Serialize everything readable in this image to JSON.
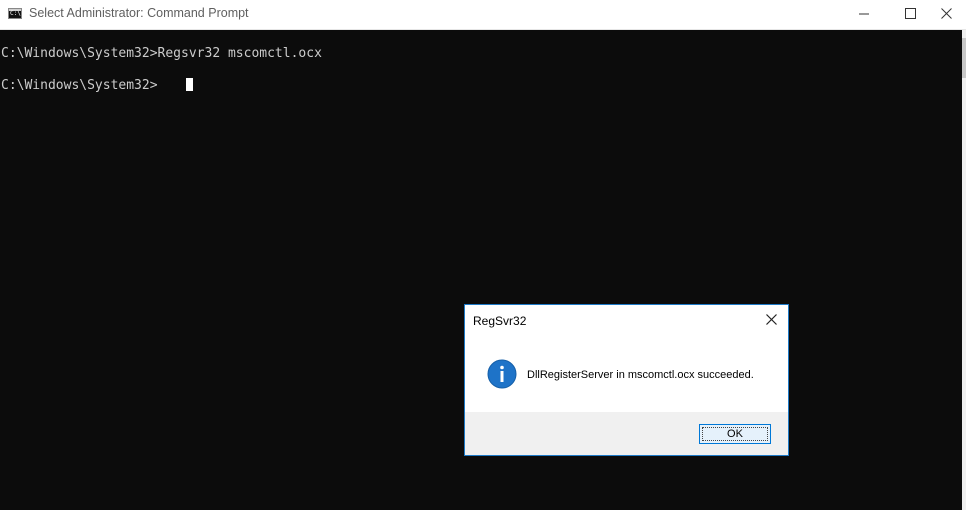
{
  "window": {
    "title": "Select Administrator: Command Prompt"
  },
  "console": {
    "lines": [
      "C:\\Windows\\System32>Regsvr32 mscomctl.ocx",
      "C:\\Windows\\System32>"
    ]
  },
  "dialog": {
    "title": "RegSvr32",
    "message": "DllRegisterServer in mscomctl.ocx succeeded.",
    "ok_label": "OK",
    "icon": "information-icon"
  },
  "colors": {
    "console_background": "#0c0c0c",
    "console_text": "#cccccc",
    "info_icon_blue": "#1e73c8",
    "dialog_border": "#1e7ac7"
  }
}
